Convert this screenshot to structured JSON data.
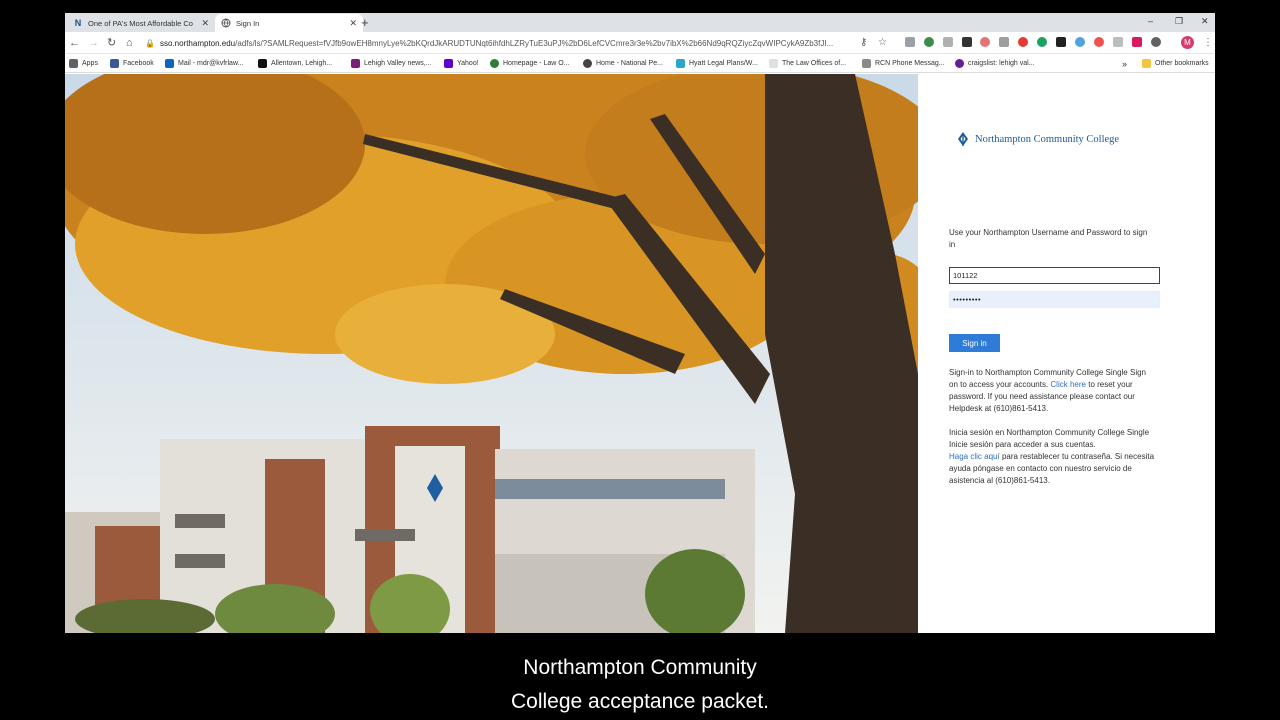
{
  "browser": {
    "tabs": [
      {
        "title": "One of PA's Most Affordable Co",
        "favicon": "N"
      },
      {
        "title": "Sign In",
        "favicon": "globe"
      }
    ],
    "new_tab_symbol": "+",
    "window_controls": {
      "minimize": "–",
      "maximize": "❐",
      "close": "✕"
    },
    "address": {
      "host": "sso.northampton.edu",
      "path": "/adfs/ls/?SAMLRequest=fVJfb9owEH8mnyLye%2bKQrdJkARUDTUNqt6ihfdhLZRyTuE3uPJ%2bD6LefCVCmre3r3e%2bv7ibX%2b66Nd9qRQZiycZqvWIPCykA9Zb3fJI..."
    },
    "bookmarks": [
      {
        "label": "Apps",
        "color": "#5f6368"
      },
      {
        "label": "Facebook",
        "color": "#3b5998"
      },
      {
        "label": "Mail - mdr@kvfrlaw...",
        "color": "#0a66c2"
      },
      {
        "label": "Allentown, Lehigh...",
        "color": "#111111"
      },
      {
        "label": "Lehigh Valley news,...",
        "color": "#7a1f7a"
      },
      {
        "label": "Yahoo!",
        "color": "#6001d2"
      },
      {
        "label": "Homepage - Law O...",
        "color": "#2e7d32"
      },
      {
        "label": "Home - National Pe...",
        "color": "#444444"
      },
      {
        "label": "Hyatt Legal Plans/W...",
        "color": "#2aa6c9"
      },
      {
        "label": "The Law Offices of...",
        "color": "#9e9e9e"
      },
      {
        "label": "RCN Phone Messag...",
        "color": "#8a8a8a"
      },
      {
        "label": "craigslist: lehigh val...",
        "color": "#6a1b9a"
      },
      {
        "label": "»",
        "color": ""
      },
      {
        "label": "Other bookmarks",
        "color": "#f4c542"
      }
    ]
  },
  "login": {
    "college_name": "Northampton Community College",
    "intro": "Use your Northampton Username and Password to sign in",
    "username_value": "101122",
    "password_value": "•••••••••",
    "signin_label": "Sign in",
    "english_pre": "Sign-in to Northampton Community College Single Sign on to access your accounts.",
    "english_link": "Click here",
    "english_post": "to reset your password. If you need assistance please contact our Helpdesk at (610)861-5413.",
    "spanish_pre": "Inicia sesión en Northampton Community College Single Inicie sesión para acceder a sus cuentas.",
    "spanish_link": "Haga clic aquí",
    "spanish_post": "para restablecer tu contraseña. Si necesita ayuda póngase en contacto con nuestro servicio de asistencia al (610)861-5413."
  },
  "caption": {
    "line1": "Northampton Community",
    "line2": "College acceptance packet."
  },
  "colors": {
    "accent": "#2f7bd8",
    "brand": "#1d5a9a",
    "link": "#2f6fbf"
  }
}
